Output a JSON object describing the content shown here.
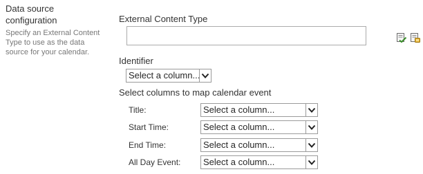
{
  "section": {
    "title": "Data source configuration",
    "description": "Specify an External Content Type to use as the data source for your calendar."
  },
  "external_content_type": {
    "label": "External Content Type",
    "value": "",
    "icons": [
      "check-names-icon",
      "browse-content-types-icon"
    ]
  },
  "identifier": {
    "label": "Identifier",
    "selected": "Select a column..."
  },
  "mapping": {
    "heading": "Select columns to map calendar event",
    "rows": [
      {
        "label": "Title:",
        "selected": "Select a column..."
      },
      {
        "label": "Start Time:",
        "selected": "Select a column..."
      },
      {
        "label": "End Time:",
        "selected": "Select a column..."
      },
      {
        "label": "All Day Event:",
        "selected": "Select a column..."
      }
    ]
  }
}
